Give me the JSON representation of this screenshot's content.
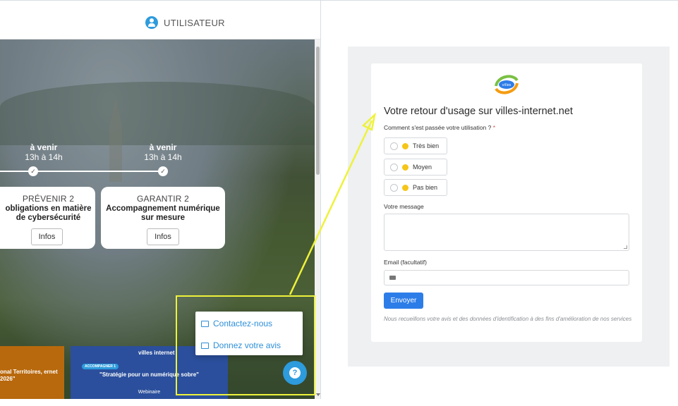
{
  "header": {
    "user_label": "UTILISATEUR"
  },
  "timeline": [
    {
      "status": "à venir",
      "time": "13h à 14h"
    },
    {
      "status": "à venir",
      "time": "13h à 14h"
    }
  ],
  "cards": [
    {
      "category": "PRÉVENIR 2",
      "title": "obligations en matière de cybersécurité",
      "button": "Infos"
    },
    {
      "category": "GARANTIR 2",
      "title": "Accompagnement numérique sur mesure",
      "button": "Infos"
    }
  ],
  "popup": {
    "contact": "Contactez-nous",
    "feedback": "Donnez votre avis"
  },
  "banners": {
    "left": {
      "text": "onal Territoires, ernet 2026\""
    },
    "right": {
      "logo": "villes internet",
      "tag": "ACCOMPAGNER 1",
      "title": "\"Stratégie pour un numérique sobre\"",
      "subtitle": "Webinaire"
    }
  },
  "form": {
    "title": "Votre retour d'usage sur villes-internet.net",
    "question": "Comment s'est passée votre utilisation ?",
    "required_mark": "*",
    "options": [
      "Très bien",
      "Moyen",
      "Pas bien"
    ],
    "message_label": "Votre message",
    "email_label": "Email (facultatif)",
    "submit_label": "Envoyer",
    "disclaimer": "Nous recueillons votre avis et des données d'identification à des fins d'amélioration de nos services"
  },
  "colors": {
    "accent": "#2d9bdc",
    "submit": "#2d7de8",
    "highlight": "#eef23a"
  },
  "icons": {
    "user": "user-icon",
    "mail": "mail-icon",
    "edit": "edit-icon",
    "chat": "chat-icon"
  }
}
